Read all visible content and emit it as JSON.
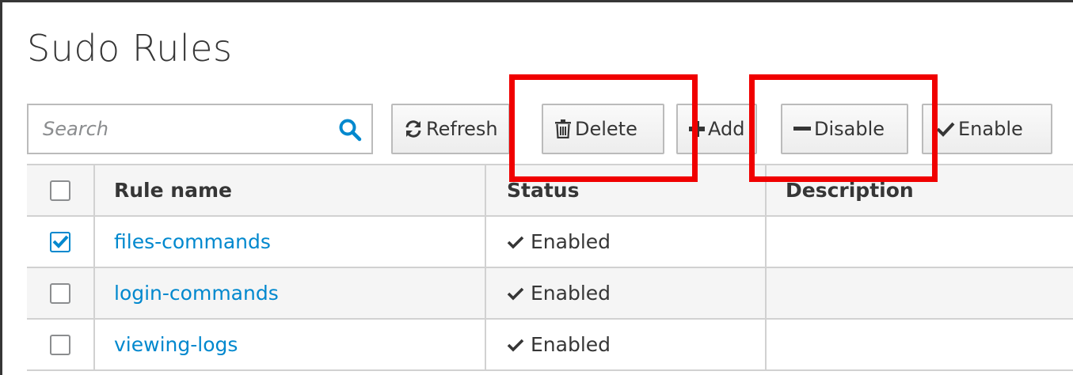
{
  "page": {
    "title": "Sudo Rules"
  },
  "search": {
    "placeholder": "Search",
    "value": ""
  },
  "toolbar": {
    "refresh_label": "Refresh",
    "delete_label": "Delete",
    "add_label": "Add",
    "disable_label": "Disable",
    "enable_label": "Enable"
  },
  "table": {
    "columns": [
      "Rule name",
      "Status",
      "Description"
    ],
    "rows": [
      {
        "name": "files-commands",
        "status": "Enabled",
        "description": "",
        "checked": true
      },
      {
        "name": "login-commands",
        "status": "Enabled",
        "description": "",
        "checked": false
      },
      {
        "name": "viewing-logs",
        "status": "Enabled",
        "description": "",
        "checked": false
      }
    ]
  },
  "icons": {
    "search": "search-icon",
    "refresh": "refresh-icon",
    "delete": "trash-icon",
    "add": "plus-icon",
    "disable": "minus-icon",
    "enable": "checkmark-icon",
    "status": "checkmark-icon"
  },
  "colors": {
    "link": "#0088ce",
    "annotation": "#f00000",
    "text": "#363636"
  }
}
